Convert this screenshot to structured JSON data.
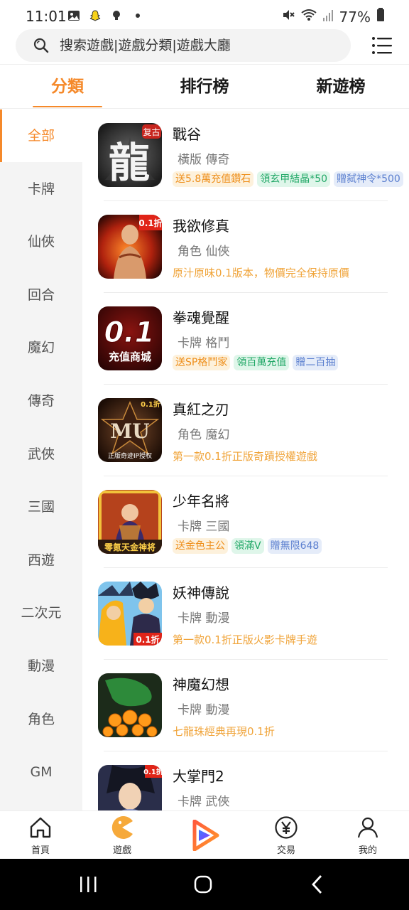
{
  "status_bar": {
    "time": "11:01",
    "battery": "77%",
    "left_icons": [
      "gallery-icon",
      "snapchat-icon",
      "bulb-icon",
      "dot-icon"
    ],
    "right_icons": [
      "mute-icon",
      "wifi-icon",
      "signal-icon",
      "battery-icon"
    ]
  },
  "search": {
    "placeholder": "搜索遊戲|遊戲分類|遊戲大廳"
  },
  "tabs": [
    {
      "label": "分類",
      "active": true
    },
    {
      "label": "排行榜",
      "active": false
    },
    {
      "label": "新遊榜",
      "active": false
    }
  ],
  "sidebar": {
    "items": [
      {
        "label": "全部",
        "active": true
      },
      {
        "label": "卡牌"
      },
      {
        "label": "仙俠"
      },
      {
        "label": "回合"
      },
      {
        "label": "魔幻"
      },
      {
        "label": "傳奇"
      },
      {
        "label": "武俠"
      },
      {
        "label": "三國"
      },
      {
        "label": "西遊"
      },
      {
        "label": "二次元"
      },
      {
        "label": "動漫"
      },
      {
        "label": "角色"
      },
      {
        "label": "GM"
      }
    ]
  },
  "games": [
    {
      "name": "戰谷",
      "tags": "橫版 傳奇",
      "promos": [
        {
          "text": "送5.8萬充值鑽石",
          "color": "orange"
        },
        {
          "text": "領玄甲結晶*50",
          "color": "green"
        },
        {
          "text": "贈弑神令*500",
          "color": "blue"
        }
      ],
      "desc": ""
    },
    {
      "name": "我欲修真",
      "tags": "角色 仙俠",
      "promos": [],
      "desc": "原汁原味0.1版本，物價完全保持原價"
    },
    {
      "name": "拳魂覺醒",
      "tags": "卡牌 格鬥",
      "promos": [
        {
          "text": "送SP格鬥家",
          "color": "orange"
        },
        {
          "text": "領百萬充值",
          "color": "green"
        },
        {
          "text": "贈二百抽",
          "color": "blue"
        }
      ],
      "desc": ""
    },
    {
      "name": "真紅之刃",
      "tags": "角色 魔幻",
      "promos": [],
      "desc": "第一款0.1折正版奇蹟授權遊戲"
    },
    {
      "name": "少年名將",
      "tags": "卡牌 三國",
      "promos": [
        {
          "text": "送金色主公",
          "color": "orange"
        },
        {
          "text": "領滿V",
          "color": "green"
        },
        {
          "text": "贈無限648",
          "color": "blue"
        }
      ],
      "desc": ""
    },
    {
      "name": "妖神傳說",
      "tags": "卡牌 動漫",
      "promos": [],
      "desc": "第一款0.1折正版火影卡牌手遊"
    },
    {
      "name": "神魔幻想",
      "tags": "卡牌 動漫",
      "promos": [],
      "desc": "七龍珠經典再現0.1折"
    },
    {
      "name": "大掌門2",
      "tags": "卡牌 武俠",
      "promos": [],
      "desc": ""
    }
  ],
  "icon_art": [
    {
      "badge": "复古",
      "glyph": "龍"
    },
    {
      "badge": "0.1折",
      "glyph": ""
    },
    {
      "badge": "",
      "glyph": "0.1",
      "sub": "充值商城"
    },
    {
      "badge": "0.1折",
      "glyph": "MU",
      "sub": "正版奇迹IP授权"
    },
    {
      "badge": "",
      "glyph": "",
      "sub": "零氪天金神将"
    },
    {
      "badge": "0.1折",
      "glyph": ""
    },
    {
      "badge": "",
      "glyph": ""
    },
    {
      "badge": "0.1折",
      "glyph": ""
    }
  ],
  "bottom_nav": [
    {
      "label": "首頁",
      "icon": "home-icon"
    },
    {
      "label": "遊戲",
      "icon": "games-icon"
    },
    {
      "label": "",
      "icon": "play-logo-icon"
    },
    {
      "label": "交易",
      "icon": "yen-icon"
    },
    {
      "label": "我的",
      "icon": "profile-icon"
    }
  ],
  "colors": {
    "accent": "#f5892a",
    "promo_orange": "#ee8f1c",
    "promo_green": "#22a867",
    "promo_blue": "#5b7fcf",
    "desc": "#f0a43a"
  }
}
